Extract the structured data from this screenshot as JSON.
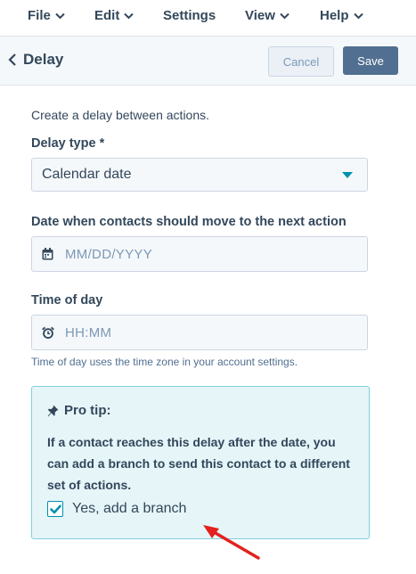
{
  "menu": [
    {
      "label": "File",
      "chevron": true
    },
    {
      "label": "Edit",
      "chevron": true
    },
    {
      "label": "Settings",
      "chevron": false
    },
    {
      "label": "View",
      "chevron": true
    },
    {
      "label": "Help",
      "chevron": true
    }
  ],
  "header": {
    "title": "Delay",
    "cancel_label": "Cancel",
    "save_label": "Save"
  },
  "form": {
    "intro": "Create a delay between actions.",
    "delay_type_label": "Delay type *",
    "delay_type_value": "Calendar date",
    "date_label": "Date when contacts should move to the next action",
    "date_placeholder": "MM/DD/YYYY",
    "time_label": "Time of day",
    "time_placeholder": "HH:MM",
    "time_help": "Time of day uses the time zone in your account settings."
  },
  "pro_tip": {
    "title": "Pro tip:",
    "body": "If a contact reaches this delay after the date, you can add a branch to send this contact to a different set of actions.",
    "checkbox_label": "Yes, add a branch",
    "checked": true
  },
  "colors": {
    "accent": "#0091ae",
    "arrow": "#e3211f",
    "save_bg": "#516f90"
  },
  "icons": [
    "chevron-down-icon",
    "chevron-left-icon",
    "calendar-icon",
    "alarm-clock-icon",
    "pushpin-icon",
    "checkmark-icon",
    "red-arrow-annotation"
  ]
}
